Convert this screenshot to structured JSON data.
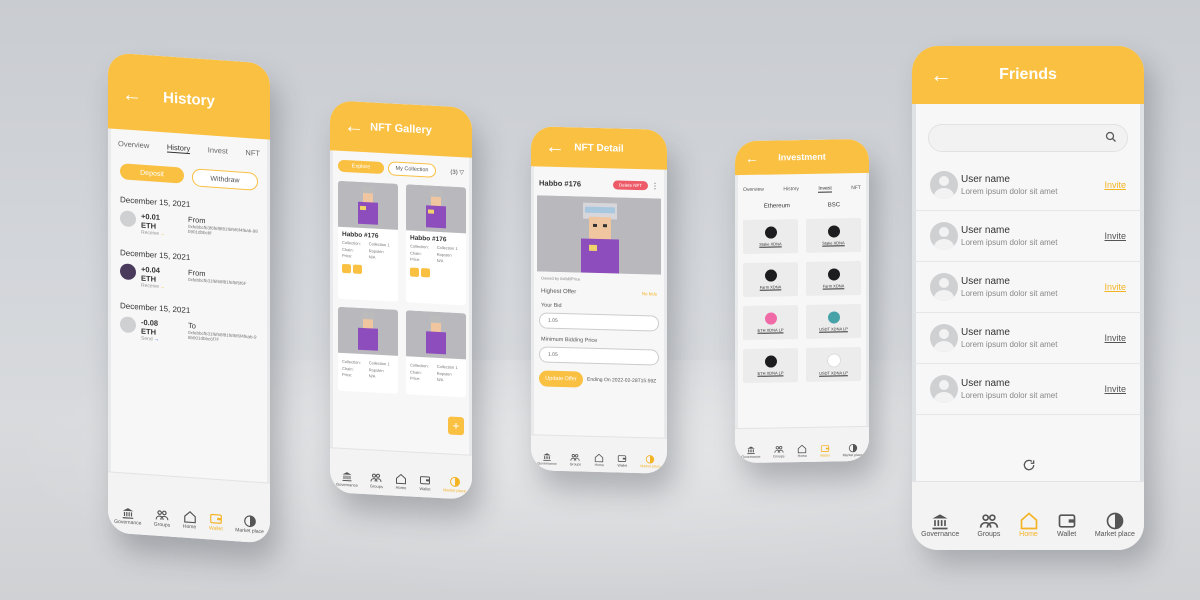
{
  "accent_color": "#f9c042",
  "nav_tabs": [
    "Governance",
    "Groups",
    "Home",
    "Wallet",
    "Market place"
  ],
  "history": {
    "title": "History",
    "tabs": [
      "Overview",
      "History",
      "Invest",
      "NFT"
    ],
    "deposit": "Deposit",
    "withdraw": "Withdraw",
    "entries": [
      {
        "date": "December 15, 2021",
        "amount": "+0.01 ETH",
        "kind": "Receive",
        "direction": "From",
        "hash": "0xfebbcfb3f6f6f8f81f6f6f6f4f6ab-98b901dbbc6f"
      },
      {
        "date": "December 15, 2021",
        "amount": "+0.04 ETH",
        "kind": "Receive",
        "direction": "From",
        "hash": "0xfebbcfb31f6f68f81f6f6f6f6F"
      },
      {
        "date": "December 15, 2021",
        "amount": "-0.08 ETH",
        "kind": "Send",
        "direction": "To",
        "hash": "0xfebbcfb31f6f68f81f6f6f6f4f6ab-98b901dbbc6f7F"
      }
    ]
  },
  "gallery": {
    "title": "NFT Gallery",
    "tab_explore": "Explore",
    "tab_collection": "My Collection",
    "count": "(3)",
    "cards": [
      {
        "name": "Habbo #176",
        "col_label": "Collection:",
        "col_val": "Collection 1",
        "chain_label": "Chain:",
        "chain_val": "Ropsten",
        "price_label": "Price:",
        "price_val": "N/A"
      },
      {
        "name": "Habbo #176",
        "col_label": "Collection:",
        "col_val": "Collection 1",
        "chain_label": "Chain:",
        "chain_val": "Ropsten",
        "price_label": "Price:",
        "price_val": "N/A"
      },
      {
        "name": "",
        "col_label": "Collection:",
        "col_val": "Collection 1",
        "chain_label": "Chain:",
        "chain_val": "Ropsten",
        "price_label": "Price:",
        "price_val": "N/A"
      },
      {
        "name": "",
        "col_label": "Collection:",
        "col_val": "Collection 1",
        "chain_label": "Chain:",
        "chain_val": "Ropsten",
        "price_label": "Price:",
        "price_val": "N/A"
      }
    ]
  },
  "detail": {
    "title": "NFT Detail",
    "name": "Habbo #176",
    "delete": "Delete NFT",
    "owner": "Owned by   0x8d0Price",
    "highest_offer": "Highest Offer",
    "highest_val": "No bids",
    "your_bid": "Your Bid",
    "bid_val": "1.05",
    "min_price": "Minimum Bidding Price",
    "min_val": "1.05",
    "update": "Update Offer",
    "ending": "Ending On 2022-02-28T15:59Z"
  },
  "investment": {
    "title": "Investment",
    "tabs": [
      "Overview",
      "History",
      "Invest",
      "NFT"
    ],
    "col_a": "Ethereum",
    "col_b": "BSC",
    "items": [
      "Stake XDNA",
      "Stake XDNA",
      "Farm XDNA",
      "Farm XDNA",
      "ETH XDNA LP",
      "USDT XDNA LP",
      "ETH XDNA LP",
      "USDT XDNA LP"
    ]
  },
  "friends": {
    "title": "Friends",
    "search_placeholder": "",
    "list": [
      {
        "name": "User name",
        "sub": "Lorem ipsum dolor sit amet",
        "invite": "Invite"
      },
      {
        "name": "User name",
        "sub": "Lorem ipsum dolor sit amet",
        "invite": "Invite"
      },
      {
        "name": "User name",
        "sub": "Lorem ipsum dolor sit amet",
        "invite": "Invite"
      },
      {
        "name": "User name",
        "sub": "Lorem ipsum dolor sit amet",
        "invite": "Invite"
      },
      {
        "name": "User name",
        "sub": "Lorem ipsum dolor sit amet",
        "invite": "Invite"
      }
    ]
  }
}
